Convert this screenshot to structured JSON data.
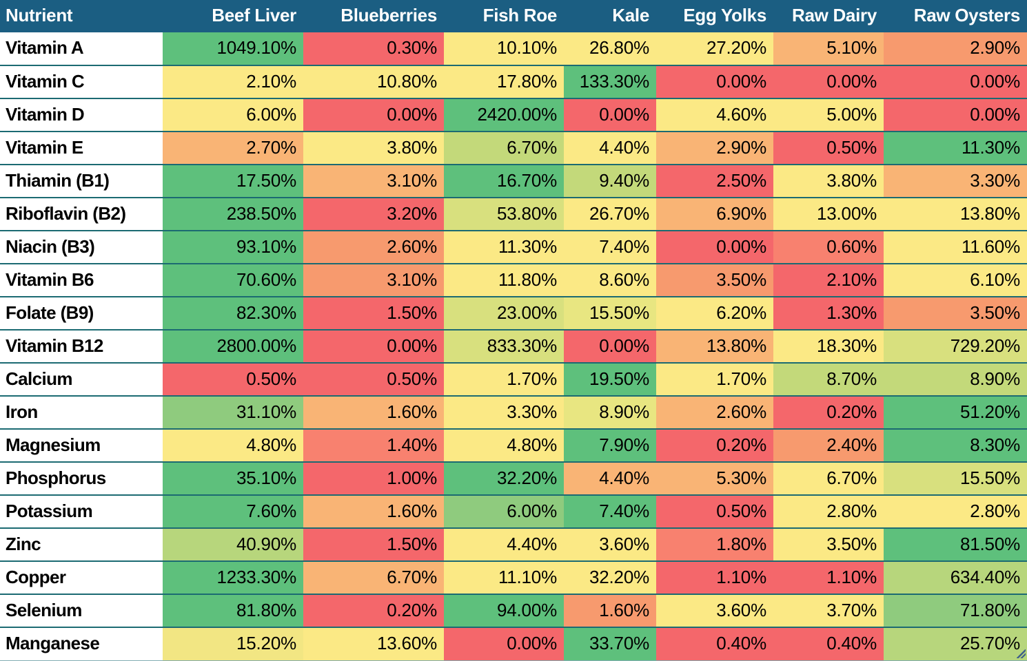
{
  "table": {
    "header": {
      "nutrient_label": "Nutrient",
      "foods": [
        "Beef Liver",
        "Blueberries",
        "Fish Roe",
        "Kale",
        "Egg Yolks",
        "Raw Dairy",
        "Raw Oysters"
      ]
    },
    "header_bg": "#1b5e82",
    "header_text": "#ffffff",
    "grid_line": "#1b6a72",
    "scale_colors": {
      "high": "#5ec07c",
      "good": "#8fcb7e",
      "mid_green": "#c3d97a",
      "yellow": "#fbe985",
      "light_yellow": "#fdeb8f",
      "orange": "#f9b475",
      "deep_orange": "#f79a6e",
      "salmon": "#f8816f",
      "red": "#f4676b"
    },
    "rows": [
      {
        "nutrient": "Vitamin A",
        "cells": [
          {
            "value": "1049.10%",
            "color": "#5ec07c"
          },
          {
            "value": "0.30%",
            "color": "#f4676b"
          },
          {
            "value": "10.10%",
            "color": "#fbe985"
          },
          {
            "value": "26.80%",
            "color": "#fbe985"
          },
          {
            "value": "27.20%",
            "color": "#fbe985"
          },
          {
            "value": "5.10%",
            "color": "#f9b475"
          },
          {
            "value": "2.90%",
            "color": "#f79a6e"
          }
        ]
      },
      {
        "nutrient": "Vitamin C",
        "cells": [
          {
            "value": "2.10%",
            "color": "#fbe985"
          },
          {
            "value": "10.80%",
            "color": "#fbe985"
          },
          {
            "value": "17.80%",
            "color": "#fbe985"
          },
          {
            "value": "133.30%",
            "color": "#5ec07c"
          },
          {
            "value": "0.00%",
            "color": "#f4676b"
          },
          {
            "value": "0.00%",
            "color": "#f4676b"
          },
          {
            "value": "0.00%",
            "color": "#f4676b"
          }
        ]
      },
      {
        "nutrient": "Vitamin D",
        "cells": [
          {
            "value": "6.00%",
            "color": "#fbe985"
          },
          {
            "value": "0.00%",
            "color": "#f4676b"
          },
          {
            "value": "2420.00%",
            "color": "#5ec07c"
          },
          {
            "value": "0.00%",
            "color": "#f4676b"
          },
          {
            "value": "4.60%",
            "color": "#fbe985"
          },
          {
            "value": "5.00%",
            "color": "#fbe985"
          },
          {
            "value": "0.00%",
            "color": "#f4676b"
          }
        ]
      },
      {
        "nutrient": "Vitamin E",
        "cells": [
          {
            "value": "2.70%",
            "color": "#f9b475"
          },
          {
            "value": "3.80%",
            "color": "#fbe985"
          },
          {
            "value": "6.70%",
            "color": "#c3d97a"
          },
          {
            "value": "4.40%",
            "color": "#fbe985"
          },
          {
            "value": "2.90%",
            "color": "#f9b475"
          },
          {
            "value": "0.50%",
            "color": "#f4676b"
          },
          {
            "value": "11.30%",
            "color": "#5ec07c"
          }
        ]
      },
      {
        "nutrient": "Thiamin (B1)",
        "cells": [
          {
            "value": "17.50%",
            "color": "#5ec07c"
          },
          {
            "value": "3.10%",
            "color": "#f9b475"
          },
          {
            "value": "16.70%",
            "color": "#5ec07c"
          },
          {
            "value": "9.40%",
            "color": "#c3d97a"
          },
          {
            "value": "2.50%",
            "color": "#f4676b"
          },
          {
            "value": "3.80%",
            "color": "#fbe985"
          },
          {
            "value": "3.30%",
            "color": "#f9b475"
          }
        ]
      },
      {
        "nutrient": "Riboflavin (B2)",
        "cells": [
          {
            "value": "238.50%",
            "color": "#5ec07c"
          },
          {
            "value": "3.20%",
            "color": "#f4676b"
          },
          {
            "value": "53.80%",
            "color": "#d8e07e"
          },
          {
            "value": "26.70%",
            "color": "#fbe985"
          },
          {
            "value": "6.90%",
            "color": "#f9b475"
          },
          {
            "value": "13.00%",
            "color": "#fbe985"
          },
          {
            "value": "13.80%",
            "color": "#fbe985"
          }
        ]
      },
      {
        "nutrient": "Niacin (B3)",
        "cells": [
          {
            "value": "93.10%",
            "color": "#5ec07c"
          },
          {
            "value": "2.60%",
            "color": "#f79a6e"
          },
          {
            "value": "11.30%",
            "color": "#fbe985"
          },
          {
            "value": "7.40%",
            "color": "#fbe985"
          },
          {
            "value": "0.00%",
            "color": "#f4676b"
          },
          {
            "value": "0.60%",
            "color": "#f8816f"
          },
          {
            "value": "11.60%",
            "color": "#fbe985"
          }
        ]
      },
      {
        "nutrient": "Vitamin B6",
        "cells": [
          {
            "value": "70.60%",
            "color": "#5ec07c"
          },
          {
            "value": "3.10%",
            "color": "#f79a6e"
          },
          {
            "value": "11.80%",
            "color": "#fbe985"
          },
          {
            "value": "8.60%",
            "color": "#fbe985"
          },
          {
            "value": "3.50%",
            "color": "#f79a6e"
          },
          {
            "value": "2.10%",
            "color": "#f4676b"
          },
          {
            "value": "6.10%",
            "color": "#fbe985"
          }
        ]
      },
      {
        "nutrient": "Folate (B9)",
        "cells": [
          {
            "value": "82.30%",
            "color": "#5ec07c"
          },
          {
            "value": "1.50%",
            "color": "#f4676b"
          },
          {
            "value": "23.00%",
            "color": "#d8e07e"
          },
          {
            "value": "15.50%",
            "color": "#e8e681"
          },
          {
            "value": "6.20%",
            "color": "#fbe985"
          },
          {
            "value": "1.30%",
            "color": "#f4676b"
          },
          {
            "value": "3.50%",
            "color": "#f79a6e"
          }
        ]
      },
      {
        "nutrient": "Vitamin B12",
        "cells": [
          {
            "value": "2800.00%",
            "color": "#5ec07c"
          },
          {
            "value": "0.00%",
            "color": "#f4676b"
          },
          {
            "value": "833.30%",
            "color": "#d8e07e"
          },
          {
            "value": "0.00%",
            "color": "#f4676b"
          },
          {
            "value": "13.80%",
            "color": "#f9b475"
          },
          {
            "value": "18.30%",
            "color": "#fbe985"
          },
          {
            "value": "729.20%",
            "color": "#d8e07e"
          }
        ]
      },
      {
        "nutrient": "Calcium",
        "cells": [
          {
            "value": "0.50%",
            "color": "#f4676b"
          },
          {
            "value": "0.50%",
            "color": "#f4676b"
          },
          {
            "value": "1.70%",
            "color": "#fbe985"
          },
          {
            "value": "19.50%",
            "color": "#5ec07c"
          },
          {
            "value": "1.70%",
            "color": "#fbe985"
          },
          {
            "value": "8.70%",
            "color": "#c3d97a"
          },
          {
            "value": "8.90%",
            "color": "#c3d97a"
          }
        ]
      },
      {
        "nutrient": "Iron",
        "cells": [
          {
            "value": "31.10%",
            "color": "#8fcb7e"
          },
          {
            "value": "1.60%",
            "color": "#f9b475"
          },
          {
            "value": "3.30%",
            "color": "#fbe985"
          },
          {
            "value": "8.90%",
            "color": "#e8e681"
          },
          {
            "value": "2.60%",
            "color": "#f9b475"
          },
          {
            "value": "0.20%",
            "color": "#f4676b"
          },
          {
            "value": "51.20%",
            "color": "#5ec07c"
          }
        ]
      },
      {
        "nutrient": "Magnesium",
        "cells": [
          {
            "value": "4.80%",
            "color": "#fbe985"
          },
          {
            "value": "1.40%",
            "color": "#f8816f"
          },
          {
            "value": "4.80%",
            "color": "#fbe985"
          },
          {
            "value": "7.90%",
            "color": "#5ec07c"
          },
          {
            "value": "0.20%",
            "color": "#f4676b"
          },
          {
            "value": "2.40%",
            "color": "#f79a6e"
          },
          {
            "value": "8.30%",
            "color": "#5ec07c"
          }
        ]
      },
      {
        "nutrient": "Phosphorus",
        "cells": [
          {
            "value": "35.10%",
            "color": "#5ec07c"
          },
          {
            "value": "1.00%",
            "color": "#f4676b"
          },
          {
            "value": "32.20%",
            "color": "#5ec07c"
          },
          {
            "value": "4.40%",
            "color": "#f9b475"
          },
          {
            "value": "5.30%",
            "color": "#f9b475"
          },
          {
            "value": "6.70%",
            "color": "#fbe985"
          },
          {
            "value": "15.50%",
            "color": "#d8e07e"
          }
        ]
      },
      {
        "nutrient": "Potassium",
        "cells": [
          {
            "value": "7.60%",
            "color": "#5ec07c"
          },
          {
            "value": "1.60%",
            "color": "#f9b475"
          },
          {
            "value": "6.00%",
            "color": "#8fcb7e"
          },
          {
            "value": "7.40%",
            "color": "#5ec07c"
          },
          {
            "value": "0.50%",
            "color": "#f4676b"
          },
          {
            "value": "2.80%",
            "color": "#fbe985"
          },
          {
            "value": "2.80%",
            "color": "#fbe985"
          }
        ]
      },
      {
        "nutrient": "Zinc",
        "cells": [
          {
            "value": "40.90%",
            "color": "#b7d67c"
          },
          {
            "value": "1.50%",
            "color": "#f4676b"
          },
          {
            "value": "4.40%",
            "color": "#fbe985"
          },
          {
            "value": "3.60%",
            "color": "#fbe985"
          },
          {
            "value": "1.80%",
            "color": "#f8816f"
          },
          {
            "value": "3.50%",
            "color": "#fbe985"
          },
          {
            "value": "81.50%",
            "color": "#5ec07c"
          }
        ]
      },
      {
        "nutrient": "Copper",
        "cells": [
          {
            "value": "1233.30%",
            "color": "#5ec07c"
          },
          {
            "value": "6.70%",
            "color": "#f9b475"
          },
          {
            "value": "11.10%",
            "color": "#fbe985"
          },
          {
            "value": "32.20%",
            "color": "#fbe985"
          },
          {
            "value": "1.10%",
            "color": "#f4676b"
          },
          {
            "value": "1.10%",
            "color": "#f4676b"
          },
          {
            "value": "634.40%",
            "color": "#b7d67c"
          }
        ]
      },
      {
        "nutrient": "Selenium",
        "cells": [
          {
            "value": "81.80%",
            "color": "#5ec07c"
          },
          {
            "value": "0.20%",
            "color": "#f4676b"
          },
          {
            "value": "94.00%",
            "color": "#5ec07c"
          },
          {
            "value": "1.60%",
            "color": "#f79a6e"
          },
          {
            "value": "3.60%",
            "color": "#fbe985"
          },
          {
            "value": "3.70%",
            "color": "#fbe985"
          },
          {
            "value": "71.80%",
            "color": "#8fcb7e"
          }
        ]
      },
      {
        "nutrient": "Manganese",
        "cells": [
          {
            "value": "15.20%",
            "color": "#f2e683"
          },
          {
            "value": "13.60%",
            "color": "#fbe985"
          },
          {
            "value": "0.00%",
            "color": "#f4676b"
          },
          {
            "value": "33.70%",
            "color": "#5ec07c"
          },
          {
            "value": "0.40%",
            "color": "#f4676b"
          },
          {
            "value": "0.40%",
            "color": "#f4676b"
          },
          {
            "value": "25.70%",
            "color": "#b7d67c"
          }
        ]
      }
    ]
  }
}
